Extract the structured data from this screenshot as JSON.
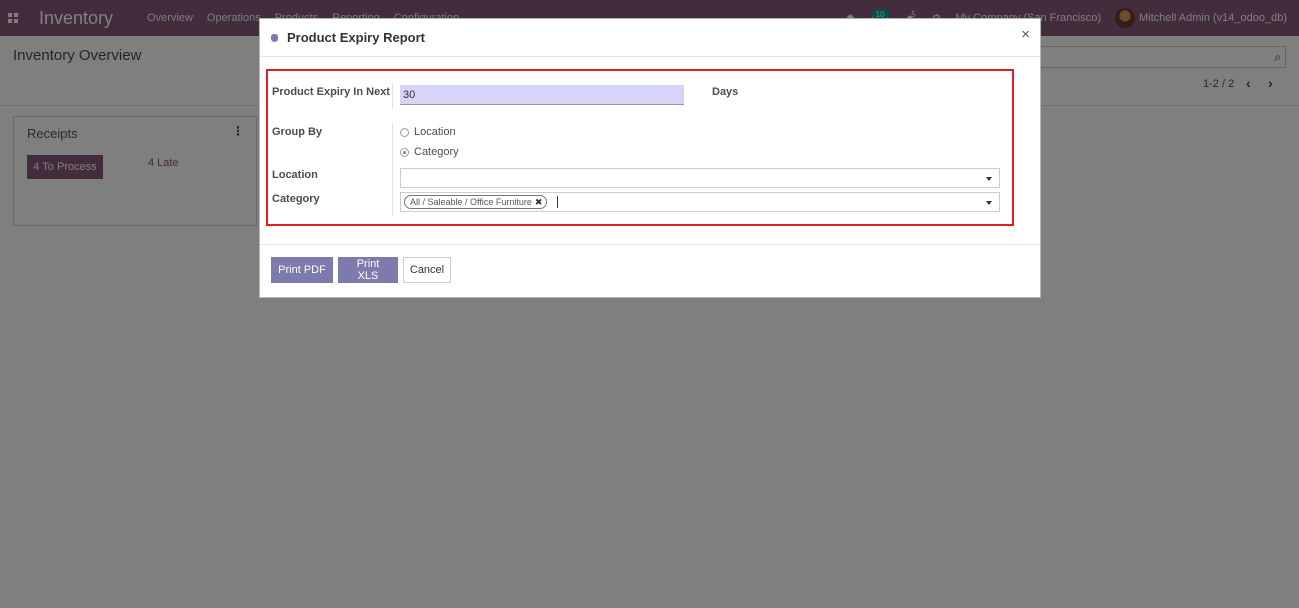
{
  "navbar": {
    "brand": "Inventory",
    "menu": [
      "Overview",
      "Operations",
      "Products",
      "Reporting",
      "Configuration"
    ],
    "activity_count": "10",
    "chat_count": "5",
    "company": "My Company (San Francisco)",
    "user": "Mitchell Admin (v14_odoo_db)"
  },
  "control_panel": {
    "title": "Inventory Overview",
    "pager": "1-2 / 2"
  },
  "kanban": {
    "card_title": "Receipts",
    "process_button": "4 To Process",
    "late_link": "4 Late"
  },
  "modal": {
    "title": "Product Expiry Report",
    "close_symbol": "×",
    "fields": {
      "expiry_label": "Product Expiry In Next",
      "expiry_value": "30",
      "days_label": "Days",
      "group_by_label": "Group By",
      "group_by_options": [
        "Location",
        "Category"
      ],
      "group_by_selected": "Category",
      "location_label": "Location",
      "location_value": "",
      "category_label": "Category",
      "category_tag": "All / Saleable / Office Furniture"
    },
    "buttons": {
      "print_pdf": "Print PDF",
      "print_xls": "Print XLS",
      "cancel": "Cancel"
    }
  },
  "colors": {
    "brand": "#875a7b",
    "primary_button": "#7c7bad",
    "highlight_border": "#e02020",
    "input_bg": "#d6d4f7"
  }
}
